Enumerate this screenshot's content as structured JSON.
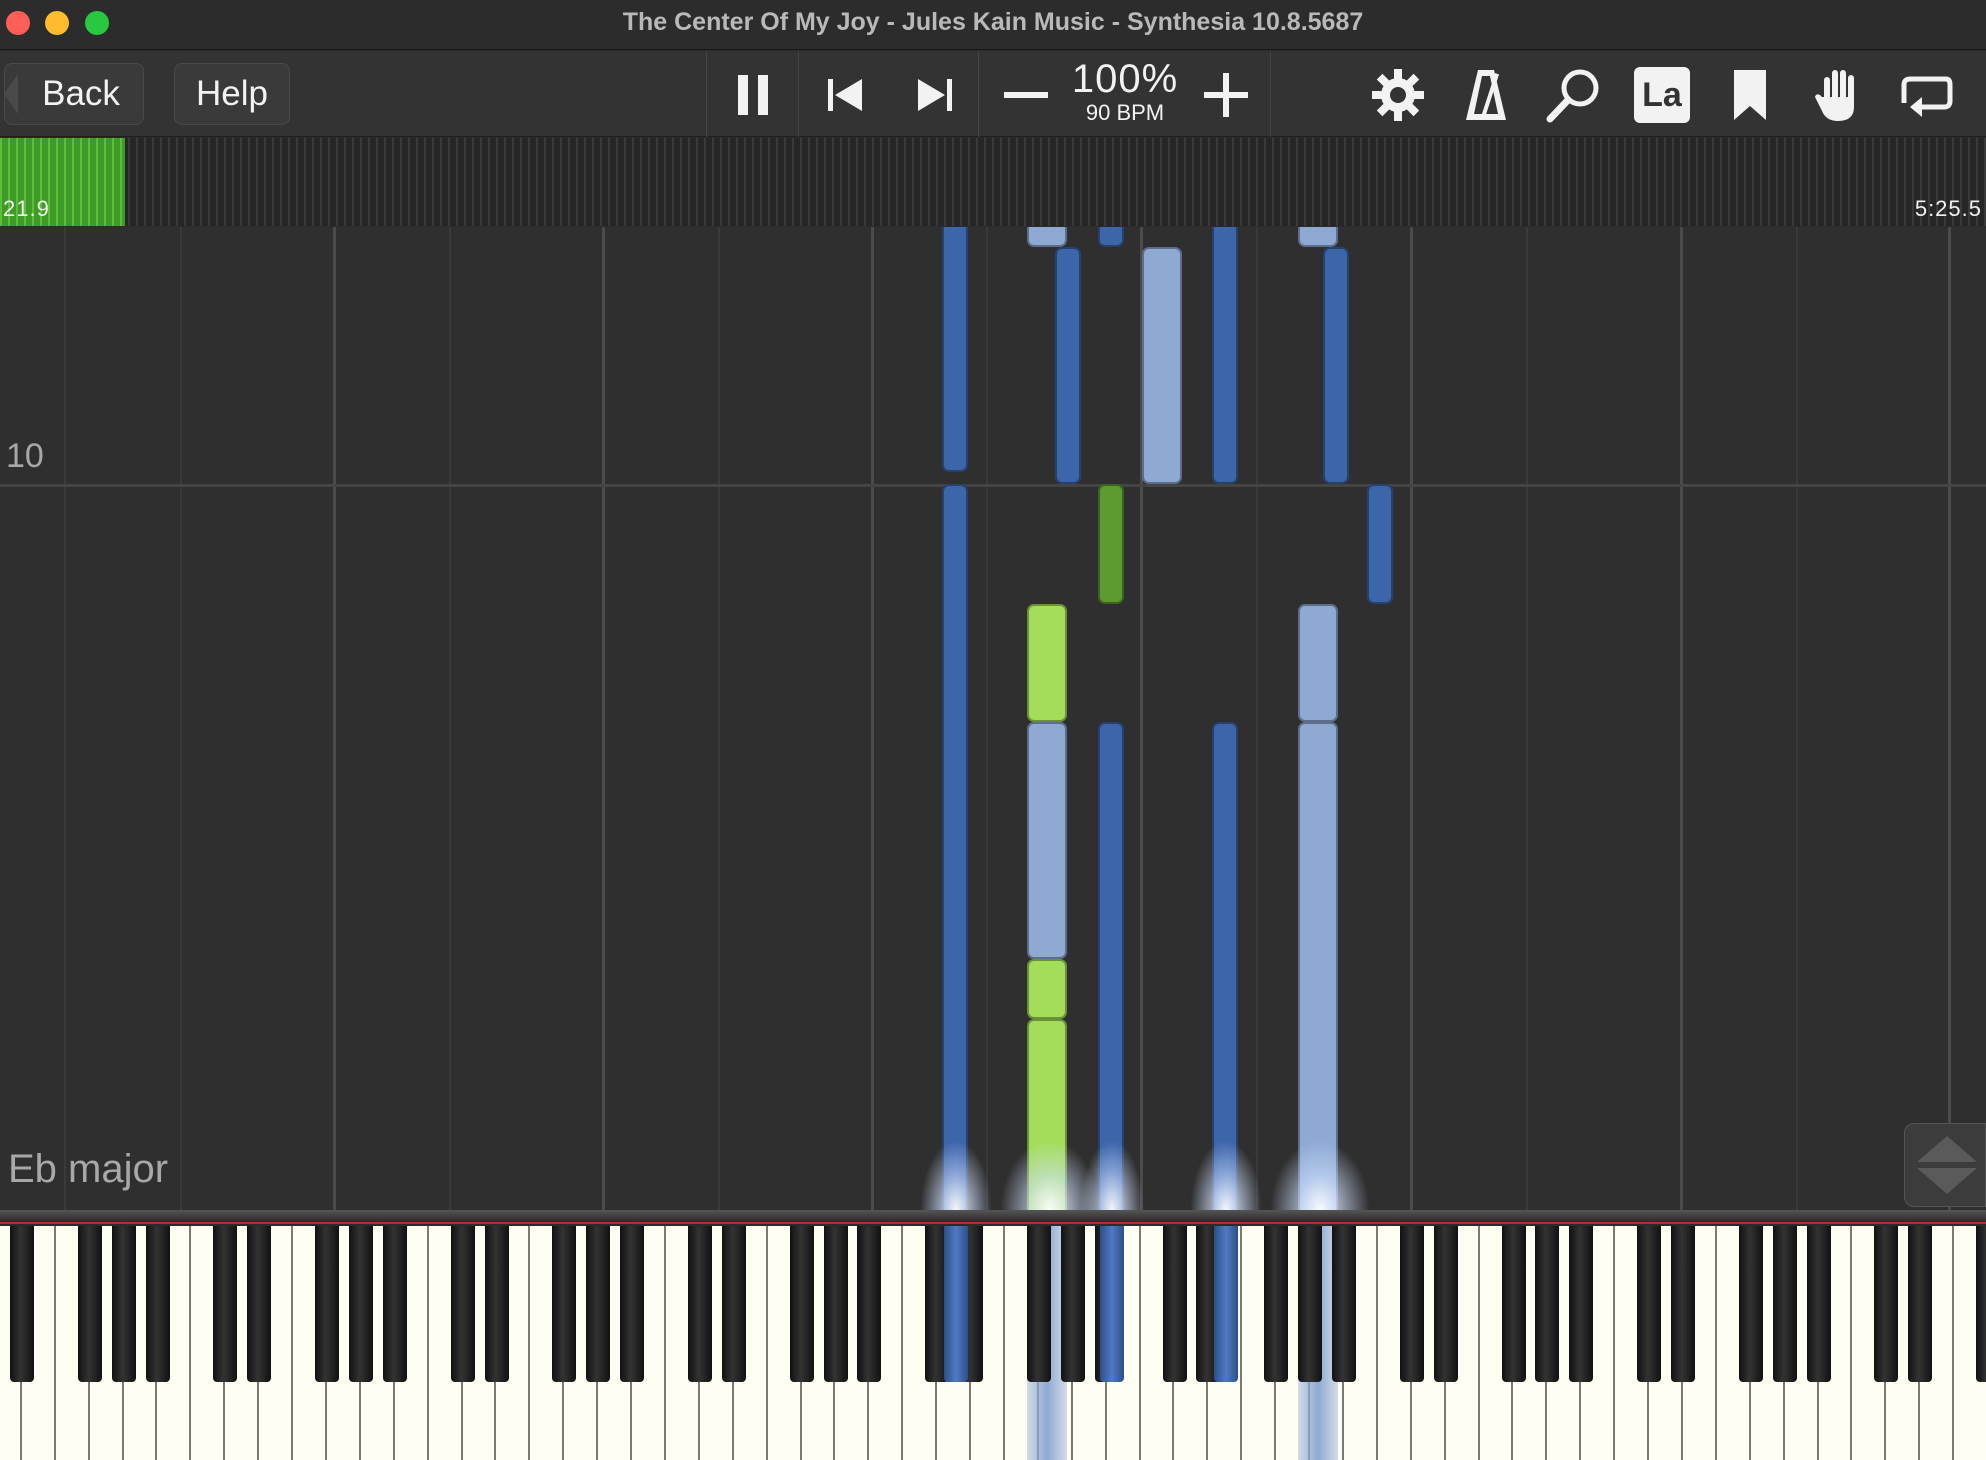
{
  "window": {
    "title": "The Center Of My Joy - Jules Kain Music - Synthesia 10.8.5687"
  },
  "toolbar": {
    "back_label": "Back",
    "help_label": "Help",
    "speed_percent": "100%",
    "tempo": "90 BPM",
    "label_mode_badge": "La"
  },
  "timeline": {
    "elapsed": "21.9",
    "total": "5:25.5",
    "progress_fraction": 0.063
  },
  "notes_view": {
    "measure_number": "10",
    "key_signature": "Eb major"
  },
  "colors": {
    "right_hand_dark": "#3d65aa",
    "right_hand_light": "#8eaad3",
    "left_hand_green": "#a3dd5a",
    "left_hand_dark_green": "#5d9a2f",
    "progress_green": "#4caf34"
  }
}
